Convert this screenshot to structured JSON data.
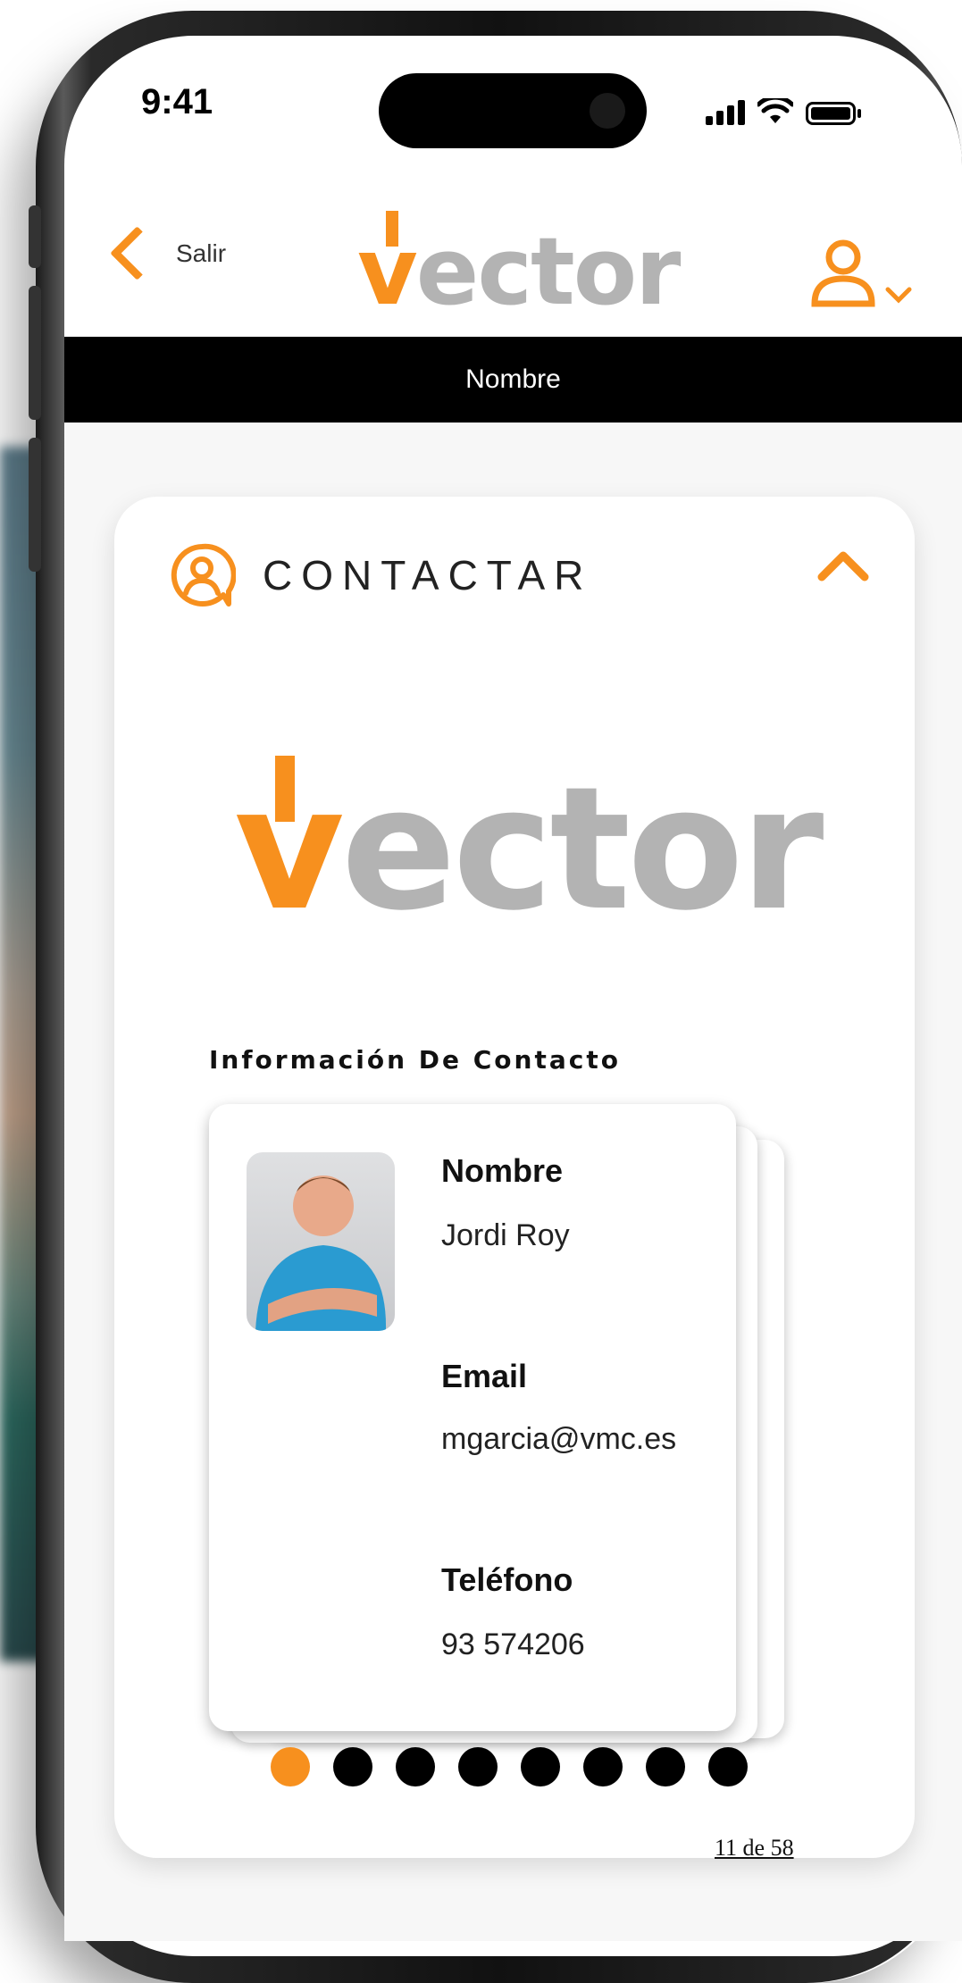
{
  "status_bar": {
    "time": "9:41"
  },
  "header": {
    "back_label": "Salir",
    "logo_v": "v",
    "logo_rest": "ector",
    "user_icon": "user-icon"
  },
  "name_bar": {
    "label": "Nombre"
  },
  "section": {
    "icon": "contact-icon",
    "title": "CONTACTAR",
    "collapse_icon": "chevron-up-icon"
  },
  "brand_logo": {
    "v": "v",
    "rest": "ector"
  },
  "contact_info": {
    "heading": "Información De Contacto",
    "fields": [
      {
        "label": "Nombre",
        "value": "Jordi Roy"
      },
      {
        "label": "Email",
        "value": "mgarcia@vmc.es"
      },
      {
        "label": "Teléfono",
        "value": "93 574206"
      }
    ]
  },
  "pagination": {
    "total_dots": 8,
    "active_index": 0,
    "text": "11 de 58"
  },
  "colors": {
    "accent": "#F7901E",
    "logo_gray": "#b3b3b3",
    "bar": "#000000"
  }
}
